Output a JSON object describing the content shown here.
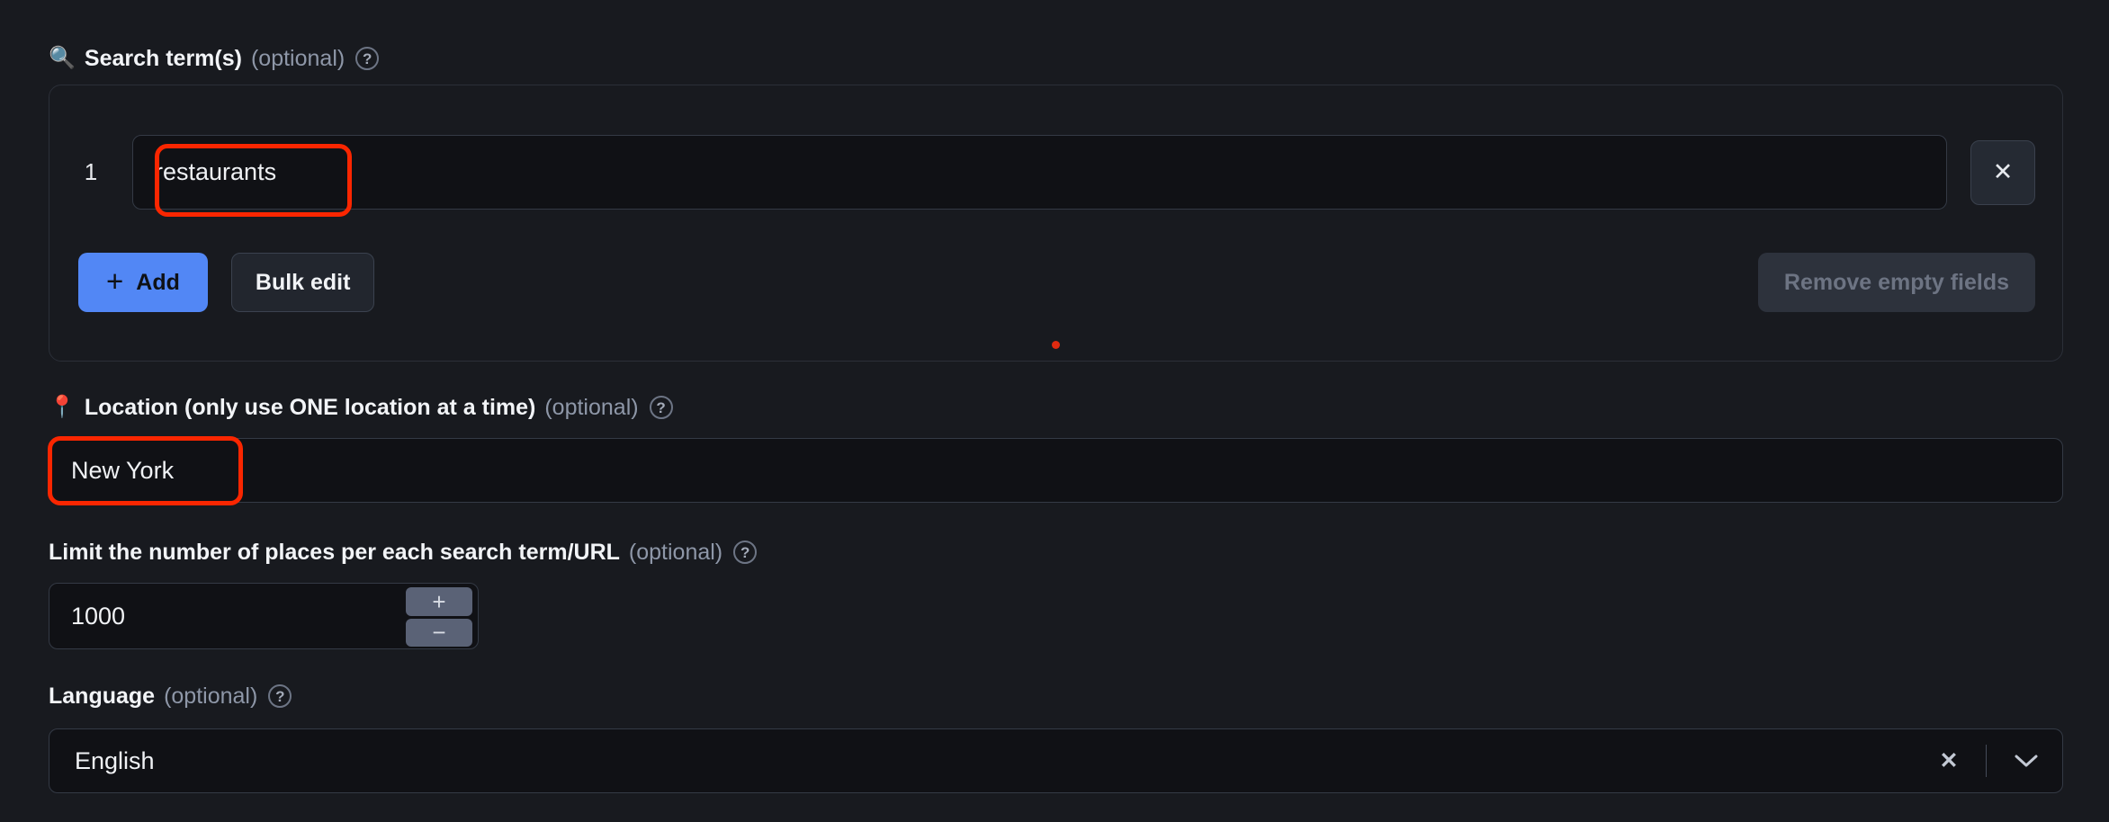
{
  "search_terms": {
    "label": "Search term(s)",
    "optional": "(optional)",
    "icon": "magnifier-icon",
    "help_icon": "?",
    "rows": [
      {
        "index": "1",
        "value": "restaurants",
        "placeholder": ""
      }
    ],
    "remove_row_icon": "✕",
    "add_label": "Add",
    "add_icon": "+",
    "bulk_edit_label": "Bulk edit",
    "remove_empty_label": "Remove empty fields"
  },
  "location": {
    "label": "Location (only use ONE location at a time)",
    "optional": "(optional)",
    "icon": "map-pin-icon",
    "help_icon": "?",
    "value": "New York",
    "placeholder": ""
  },
  "limit": {
    "label": "Limit the number of places per each search term/URL",
    "optional": "(optional)",
    "help_icon": "?",
    "value": "1000",
    "increment_icon": "+",
    "decrement_icon": "−"
  },
  "language": {
    "label": "Language",
    "optional": "(optional)",
    "help_icon": "?",
    "value": "English",
    "clear_icon": "✕",
    "chevron_icon": "chevron-down-icon"
  },
  "colors": {
    "page_background": "#181a1f",
    "input_background": "#101115",
    "primary_button": "#5287f5",
    "annotation_highlight": "#fa2600",
    "stepper_button": "#5a6276"
  }
}
